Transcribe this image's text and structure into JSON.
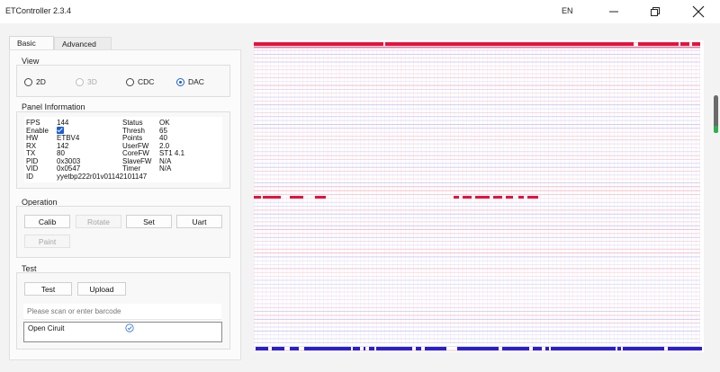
{
  "window": {
    "title": "ETController 2.3.4",
    "language": "EN"
  },
  "tabs": [
    {
      "label": "Basic",
      "active": true
    },
    {
      "label": "Advanced",
      "active": false
    }
  ],
  "view": {
    "title": "View",
    "options": [
      {
        "label": "2D",
        "checked": false,
        "enabled": true
      },
      {
        "label": "3D",
        "checked": false,
        "enabled": false
      },
      {
        "label": "CDC",
        "checked": false,
        "enabled": true
      },
      {
        "label": "DAC",
        "checked": true,
        "enabled": true
      }
    ]
  },
  "panel_info": {
    "title": "Panel Information",
    "left": [
      {
        "key": "FPS",
        "value": "144"
      },
      {
        "key": "Enable",
        "value": ""
      },
      {
        "key": "HW",
        "value": "ETBV4"
      },
      {
        "key": "RX",
        "value": "142"
      },
      {
        "key": "TX",
        "value": "80"
      },
      {
        "key": "PID",
        "value": "0x3003"
      },
      {
        "key": "VID",
        "value": "0x0547"
      },
      {
        "key": "ID",
        "value": "yyetbp222r01v01142101147"
      }
    ],
    "right": [
      {
        "key": "Status",
        "value": "OK"
      },
      {
        "key": "Thresh",
        "value": "65"
      },
      {
        "key": "Points",
        "value": "40"
      },
      {
        "key": "UserFW",
        "value": "2.0"
      },
      {
        "key": "CoreFW",
        "value": "ST1 4.1"
      },
      {
        "key": "SlaveFW",
        "value": "N/A"
      },
      {
        "key": "Timer",
        "value": "N/A"
      }
    ],
    "enable_checked": true
  },
  "operation": {
    "title": "Operation",
    "buttons": [
      {
        "label": "Calib",
        "enabled": true
      },
      {
        "label": "Rotate",
        "enabled": false
      },
      {
        "label": "Set",
        "enabled": true
      },
      {
        "label": "Uart",
        "enabled": true
      },
      {
        "label": "Paint",
        "enabled": false
      }
    ]
  },
  "test": {
    "title": "Test",
    "test_label": "Test",
    "upload_label": "Upload",
    "barcode_placeholder": "Please scan or enter barcode",
    "result_label": "Open Ciruit",
    "result_icon": "check-circle-icon"
  },
  "colors": {
    "accent": "#1a5fd0",
    "heat_high": "#e8103c",
    "heat_low": "#2a1fd0"
  },
  "heatmap": {
    "rows": 80,
    "cols": 142,
    "view": "DAC"
  }
}
